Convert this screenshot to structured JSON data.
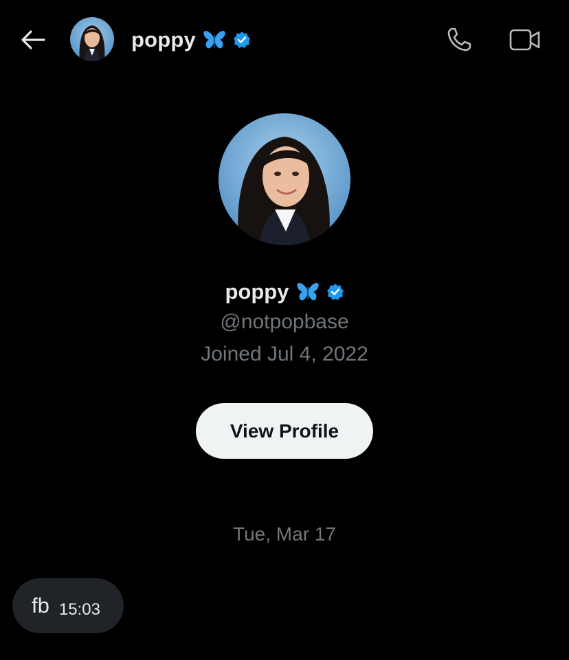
{
  "header": {
    "name": "poppy",
    "back_icon": "arrow-left-icon",
    "call_icon": "phone-icon",
    "video_icon": "video-camera-icon"
  },
  "profile": {
    "name": "poppy",
    "handle": "@notpopbase",
    "joined": "Joined Jul 4, 2022",
    "view_profile_label": "View Profile",
    "verified_color": "#1d9bf0",
    "butterfly_color": "#3aa0f0"
  },
  "chat": {
    "date": "Tue, Mar 17",
    "messages": [
      {
        "text": "fb",
        "time": "15:03"
      }
    ]
  }
}
